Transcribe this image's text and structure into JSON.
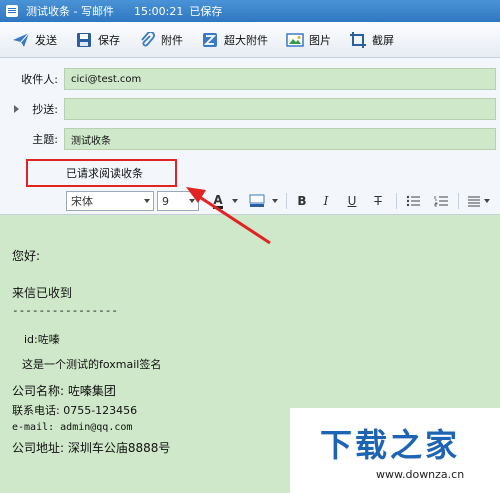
{
  "window": {
    "title": "测试收条 - 写邮件",
    "time": "15:00:21",
    "saved": "已保存"
  },
  "toolbar": {
    "send_label": "发送",
    "save_label": "保存",
    "attach_label": "附件",
    "bigattach_label": "超大附件",
    "image_label": "图片",
    "screenshot_label": "截屏"
  },
  "fields": {
    "to_label": "收件人:",
    "to_value": "cici@test.com",
    "cc_label": "抄送:",
    "cc_value": "",
    "subject_label": "主题:",
    "subject_value": "测试收条",
    "receipt_label": "已请求阅读收条"
  },
  "format": {
    "font_name": "宋体",
    "font_size": "9"
  },
  "body": {
    "greeting": "您好:",
    "received": "来信已收到",
    "divider": "----------------",
    "id_line": "id:咗嗪",
    "signature_line": "这是一个测试的foxmail签名",
    "company": "公司名称: 咗嗪集团",
    "phone": "联系电话: 0755-123456",
    "email": "e-mail: admin@qq.com",
    "address": "公司地址: 深圳车公庙8888号"
  },
  "watermark": {
    "title": "下载之家",
    "url": "www.downza.cn"
  },
  "colors": {
    "titlebar": "#2f78c2",
    "field_bg": "#cfe8c9",
    "highlight": "#e02424",
    "watermark": "#1e64b4"
  }
}
